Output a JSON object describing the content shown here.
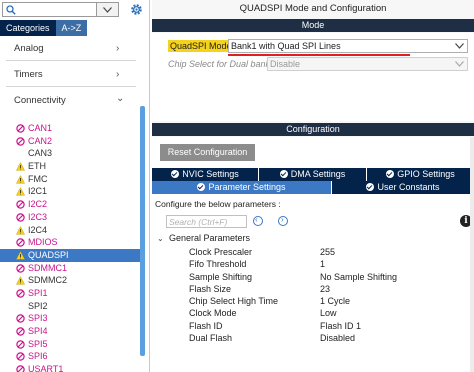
{
  "left_panel": {
    "search": {
      "value": "",
      "placeholder": ""
    },
    "tabs": [
      {
        "label": "Categories",
        "active": true
      },
      {
        "label": "A->Z",
        "active": false
      }
    ],
    "groups": [
      {
        "label": "Analog",
        "expanded": false
      },
      {
        "label": "Timers",
        "expanded": false
      },
      {
        "label": "Connectivity",
        "expanded": true
      }
    ],
    "peripherals": [
      {
        "label": "CAN1",
        "status": "disabled",
        "color": "magenta"
      },
      {
        "label": "CAN2",
        "status": "disabled",
        "color": "magenta"
      },
      {
        "label": "CAN3",
        "status": "none",
        "color": "normal"
      },
      {
        "label": "ETH",
        "status": "warning",
        "color": "normal"
      },
      {
        "label": "FMC",
        "status": "warning",
        "color": "normal"
      },
      {
        "label": "I2C1",
        "status": "warning",
        "color": "normal"
      },
      {
        "label": "I2C2",
        "status": "disabled",
        "color": "magenta"
      },
      {
        "label": "I2C3",
        "status": "disabled",
        "color": "magenta"
      },
      {
        "label": "I2C4",
        "status": "warning",
        "color": "normal"
      },
      {
        "label": "MDIOS",
        "status": "disabled",
        "color": "magenta"
      },
      {
        "label": "QUADSPI",
        "status": "warning",
        "color": "selected"
      },
      {
        "label": "SDMMC1",
        "status": "disabled",
        "color": "magenta"
      },
      {
        "label": "SDMMC2",
        "status": "warning",
        "color": "normal"
      },
      {
        "label": "SPI1",
        "status": "disabled",
        "color": "magenta"
      },
      {
        "label": "SPI2",
        "status": "none",
        "color": "normal"
      },
      {
        "label": "SPI3",
        "status": "disabled",
        "color": "magenta"
      },
      {
        "label": "SPI4",
        "status": "disabled",
        "color": "magenta"
      },
      {
        "label": "SPI5",
        "status": "disabled",
        "color": "magenta"
      },
      {
        "label": "SPI6",
        "status": "disabled",
        "color": "magenta"
      },
      {
        "label": "USART1",
        "status": "disabled",
        "color": "magenta"
      }
    ]
  },
  "window": {
    "title": "QUADSPI Mode and Configuration"
  },
  "mode": {
    "header": "Mode",
    "quadspi_mode_label": "QuadSPI Mode",
    "quadspi_mode_value": "Bank1 with Quad SPI Lines",
    "chip_select_label": "Chip Select for Dual bank",
    "chip_select_value": "Disable"
  },
  "configuration": {
    "header": "Configuration",
    "reset_label": "Reset Configuration",
    "tabs_row1": [
      "NVIC Settings",
      "DMA Settings",
      "GPIO Settings"
    ],
    "tabs_row2": [
      "Parameter Settings",
      "User Constants"
    ],
    "active_tab": "Parameter Settings",
    "caption": "Configure the below parameters :",
    "search_placeholder": "Search (Ctrl+F)",
    "group_label": "General Parameters",
    "parameters": [
      {
        "name": "Clock Prescaler",
        "value": "255"
      },
      {
        "name": "Fifo Threshold",
        "value": "1"
      },
      {
        "name": "Sample Shifting",
        "value": "No Sample Shifting"
      },
      {
        "name": "Flash Size",
        "value": "23"
      },
      {
        "name": "Chip Select High Time",
        "value": "1 Cycle"
      },
      {
        "name": "Clock Mode",
        "value": "Low"
      },
      {
        "name": "Flash ID",
        "value": "Flash ID 1"
      },
      {
        "name": "Dual Flash",
        "value": "Disabled"
      }
    ]
  },
  "colors": {
    "dark_navy": "#03234b",
    "bar_dark": "#1e2e44",
    "selected_blue": "#3c78c3",
    "magenta_text": "#c8148c",
    "warning_yellow": "#f5d21c",
    "highlight_underline": "#e02020"
  }
}
